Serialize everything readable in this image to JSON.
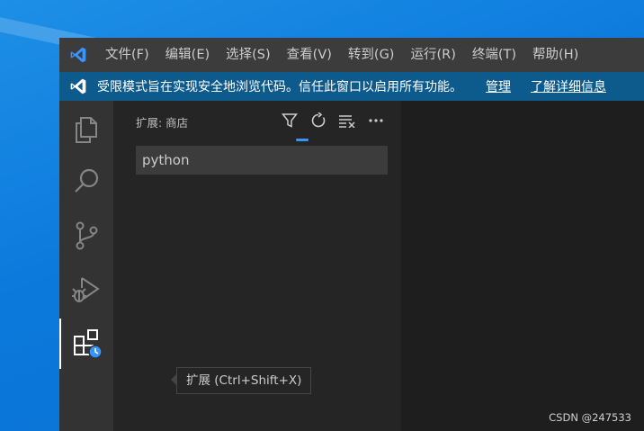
{
  "colors": {
    "titlebar": "#3c3c3c",
    "banner": "#0d5a8c",
    "activitybar": "#333333",
    "sidebar": "#252526",
    "editor": "#1e1e1e",
    "accent": "#3794ff"
  },
  "menu": [
    {
      "label": "文件(F)"
    },
    {
      "label": "编辑(E)"
    },
    {
      "label": "选择(S)"
    },
    {
      "label": "查看(V)"
    },
    {
      "label": "转到(G)"
    },
    {
      "label": "运行(R)"
    },
    {
      "label": "终端(T)"
    },
    {
      "label": "帮助(H)"
    }
  ],
  "banner": {
    "icon": "vscode-logo-icon",
    "text": "受限模式旨在实现安全地浏览代码。信任此窗口以启用所有功能。",
    "manage_link": "管理",
    "learn_more_link": "了解详细信息"
  },
  "activity_bar": [
    {
      "icon": "explorer-files-icon"
    },
    {
      "icon": "search-icon"
    },
    {
      "icon": "source-control-icon"
    },
    {
      "icon": "run-debug-icon"
    },
    {
      "icon": "extensions-icon",
      "active": true
    }
  ],
  "sidebar": {
    "title": "扩展: 商店",
    "actions": [
      {
        "icon": "filter-icon"
      },
      {
        "icon": "refresh-icon"
      },
      {
        "icon": "clear-list-icon"
      },
      {
        "icon": "more-actions-icon"
      }
    ],
    "search_value": "python"
  },
  "tooltip": {
    "text": "扩展 (Ctrl+Shift+X)"
  },
  "watermark": "CSDN @247533"
}
